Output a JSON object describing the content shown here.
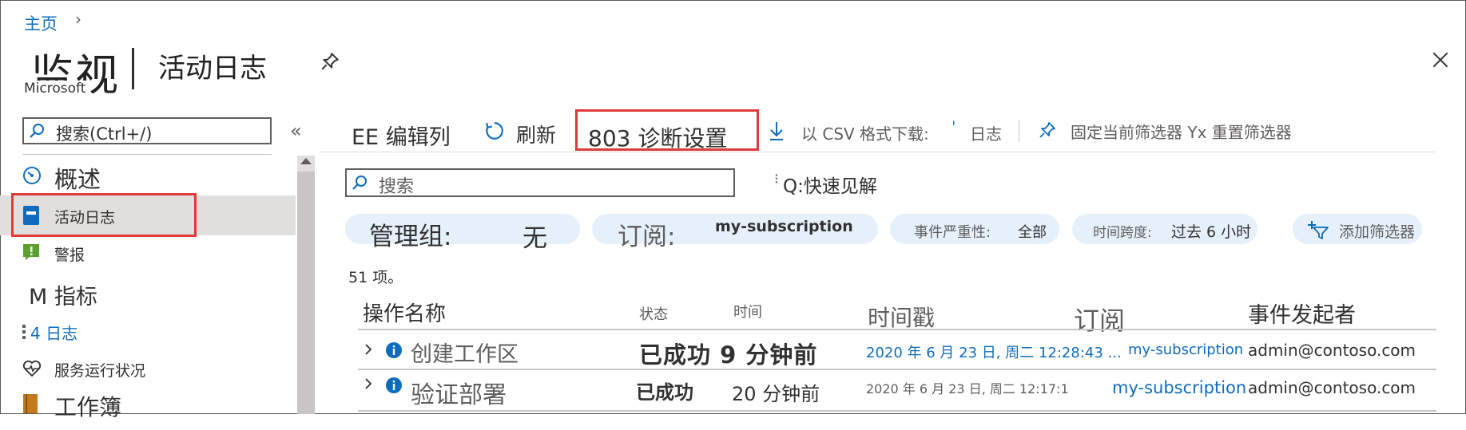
{
  "breadcrumb": {
    "home": "主页"
  },
  "header": {
    "title": "监视",
    "subtitle": "活动日志",
    "provider": "Microsoft"
  },
  "sidebar": {
    "search_placeholder": "搜索(Ctrl+/)",
    "collapse": "«",
    "items": [
      {
        "label": "概述",
        "icon": "gauge-icon"
      },
      {
        "label": "活动日志",
        "icon": "log-book-icon",
        "active": true
      },
      {
        "label": "警报",
        "icon": "alert-icon"
      },
      {
        "label": "M 指标",
        "icon": ""
      },
      {
        "label": "4 日志",
        "icon": ""
      },
      {
        "label": "服务运行状况",
        "icon": "heart-icon"
      },
      {
        "label": "工作簿",
        "icon": "workbook-icon"
      }
    ]
  },
  "toolbar": {
    "edit_columns": "EE 编辑列",
    "refresh": "刷新",
    "diagnostic_settings": "803 诊断设置",
    "download_csv": "以 CSV 格式下载:",
    "logs": "日志",
    "pin_filters": "固定当前筛选器 Yx 重置筛选器"
  },
  "search": {
    "placeholder": "搜索",
    "quick_insights": "Q:快速见解"
  },
  "filters": {
    "management_group_label": "管理组:",
    "management_group_value": "无",
    "subscription_label": "订阅:",
    "subscription_value": "my-subscription",
    "severity_label": "事件严重性:",
    "severity_value": "全部",
    "timespan_label": "时间跨度:",
    "timespan_value": "过去 6 小时",
    "add_filter": "添加筛选器"
  },
  "table": {
    "count": "51 项。",
    "columns": [
      "操作名称",
      "状态",
      "时间",
      "时间戳",
      "订阅",
      "事件发起者"
    ],
    "rows": [
      {
        "operation": "创建工作区",
        "status_time": "已成功 9 分钟前",
        "timestamp": "2020 年 6 月 23 日, 周二 12:28:43 ...",
        "subscription": "my-subscription",
        "initiator": "admin@contoso.com"
      },
      {
        "operation": "验证部署",
        "status": "已成功",
        "time": "20 分钟前",
        "timestamp": "2020 年 6 月 23 日, 周二 12:17:1",
        "subscription": "my-subscription",
        "initiator": "admin@contoso.com"
      }
    ]
  },
  "colors": {
    "accent": "#0f6cbd",
    "highlight_border": "#e03a3a",
    "pill_bg": "#e6f0fb",
    "active_bg": "#e1dfdd"
  }
}
